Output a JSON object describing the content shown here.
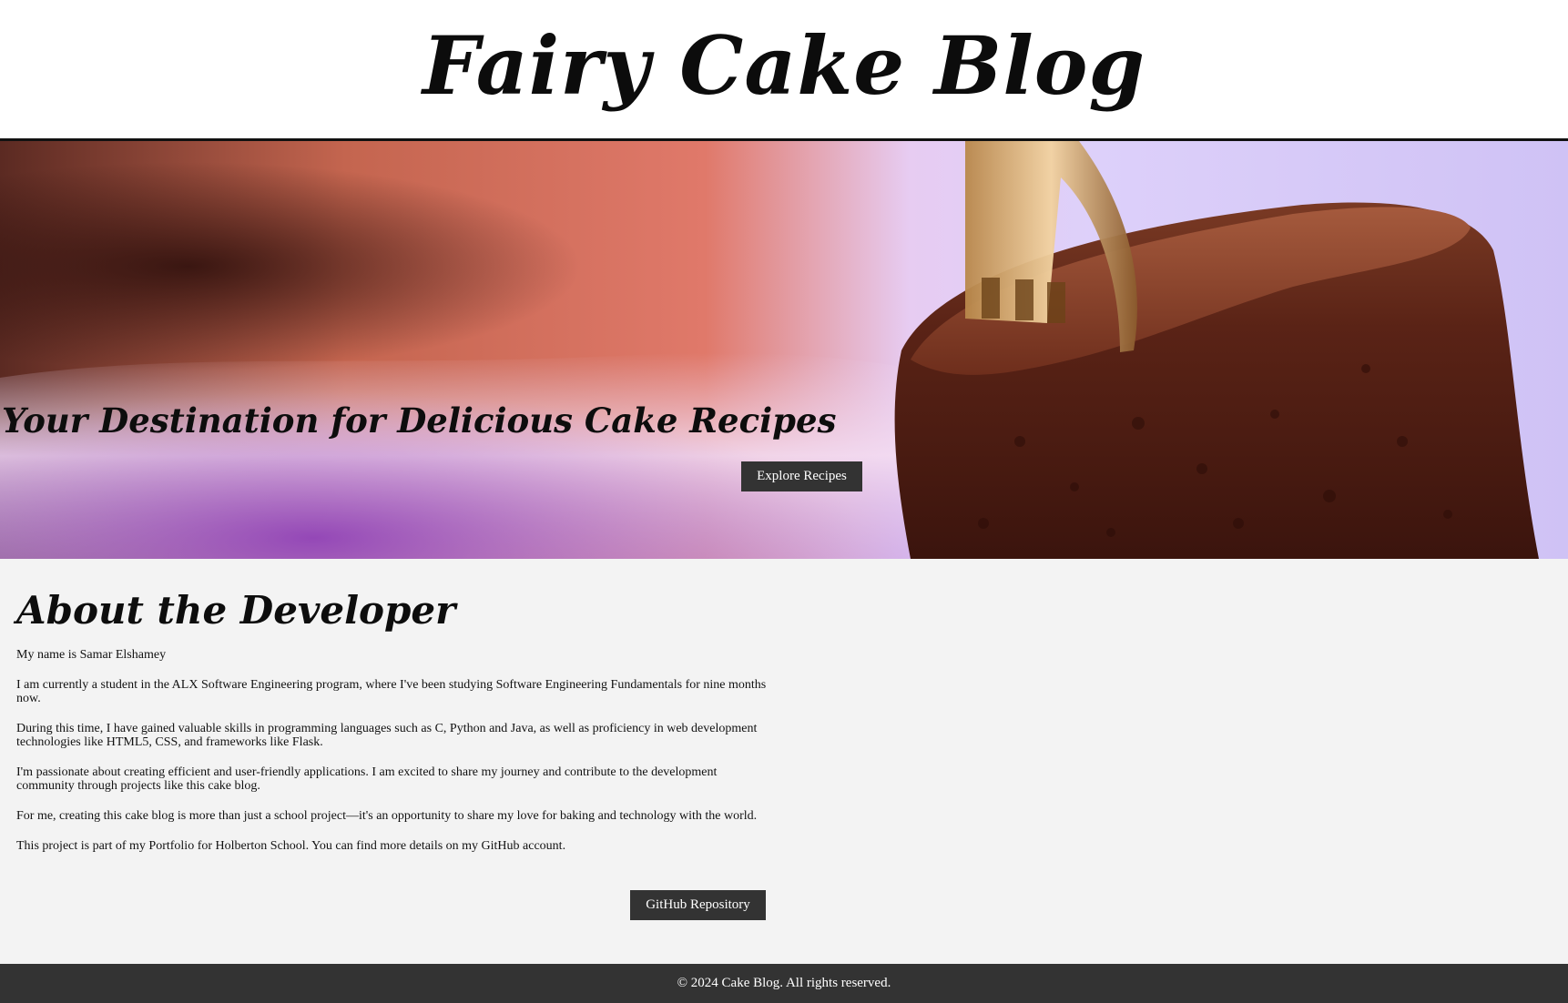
{
  "header": {
    "title": "Fairy Cake Blog"
  },
  "hero": {
    "tagline": "Your Destination for Delicious Cake Recipes",
    "button_label": "Explore Recipes"
  },
  "about": {
    "title": "About the Developer",
    "paragraphs": [
      "My name is Samar Elshamey",
      "I am currently a student in the ALX Software Engineering program, where I've been studying Software Engineering Fundamentals for nine months now.",
      "During this time, I have gained valuable skills in programming languages such as C, Python and Java, as well as proficiency in web development technologies like HTML5, CSS, and frameworks like Flask.",
      "I'm passionate about creating efficient and user-friendly applications. I am excited to share my journey and contribute to the development community through projects like this cake blog.",
      "For me, creating this cake blog is more than just a school project—it's an opportunity to share my love for baking and technology with the world.",
      "This project is part of my Portfolio for Holberton School. You can find more details on my GitHub account."
    ],
    "button_label": "GitHub Repository"
  },
  "footer": {
    "text": "© 2024 Cake Blog. All rights reserved."
  },
  "colors": {
    "button_bg": "#333333",
    "footer_bg": "#333333",
    "section_bg": "#f3f3f3",
    "header_bg": "#ffffff"
  }
}
